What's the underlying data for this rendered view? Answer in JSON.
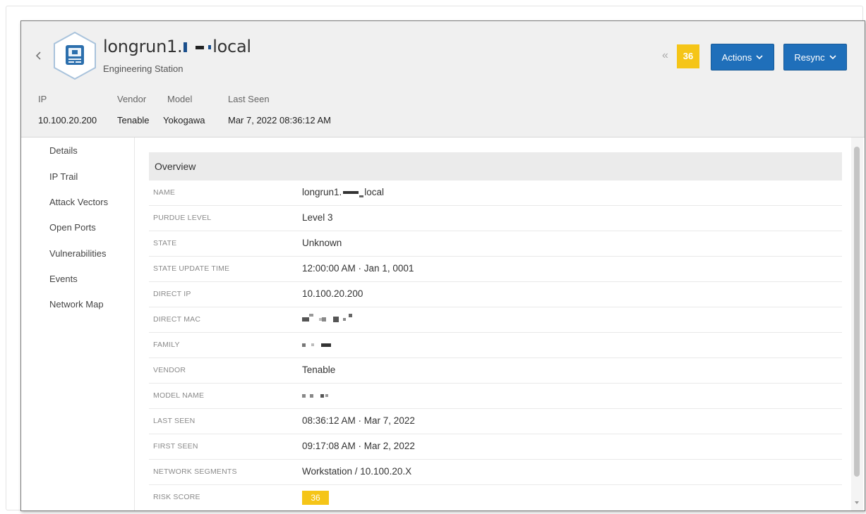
{
  "device": {
    "name_prefix": "longrun1.",
    "name_suffix": "local",
    "type": "Engineering Station",
    "icon": "computer-icon"
  },
  "meta": {
    "ip_label": "IP",
    "ip_value": "10.100.20.200",
    "vendor_label": "Vendor",
    "vendor_value": "Tenable",
    "model_label": "Model",
    "model_value": "Yokogawa",
    "last_seen_label": "Last Seen",
    "last_seen_value": "Mar 7, 2022 08:36:12 AM"
  },
  "toolbar": {
    "collapse_icon": "double-chevron-left-icon",
    "risk_score": "36",
    "actions_label": "Actions",
    "resync_label": "Resync"
  },
  "colors": {
    "primary_button": "#1f6fba",
    "risk_badge": "#f5c518",
    "header_bg": "#f0f0f0"
  },
  "sidebar": {
    "items": [
      {
        "label": "Details"
      },
      {
        "label": "IP Trail"
      },
      {
        "label": "Attack Vectors"
      },
      {
        "label": "Open Ports"
      },
      {
        "label": "Vulnerabilities"
      },
      {
        "label": "Events"
      },
      {
        "label": "Network Map"
      }
    ]
  },
  "overview": {
    "title": "Overview",
    "rows": [
      {
        "label": "Name",
        "value": "longrun1.",
        "value_suffix": "local"
      },
      {
        "label": "Purdue Level",
        "value": "Level 3"
      },
      {
        "label": "State",
        "value": "Unknown"
      },
      {
        "label": "State Update Time",
        "value": "12:00:00 AM · Jan 1, 0001"
      },
      {
        "label": "Direct IP",
        "value": "10.100.20.200"
      },
      {
        "label": "Direct MAC",
        "value": ""
      },
      {
        "label": "Family",
        "value": ""
      },
      {
        "label": "Vendor",
        "value": "Tenable"
      },
      {
        "label": "Model Name",
        "value": ""
      },
      {
        "label": "Last Seen",
        "value": "08:36:12 AM · Mar 7, 2022"
      },
      {
        "label": "First Seen",
        "value": "09:17:08 AM · Mar 2, 2022"
      },
      {
        "label": "Network Segments",
        "value": "Workstation / 10.100.20.X"
      },
      {
        "label": "Risk Score",
        "value": "36"
      }
    ]
  }
}
